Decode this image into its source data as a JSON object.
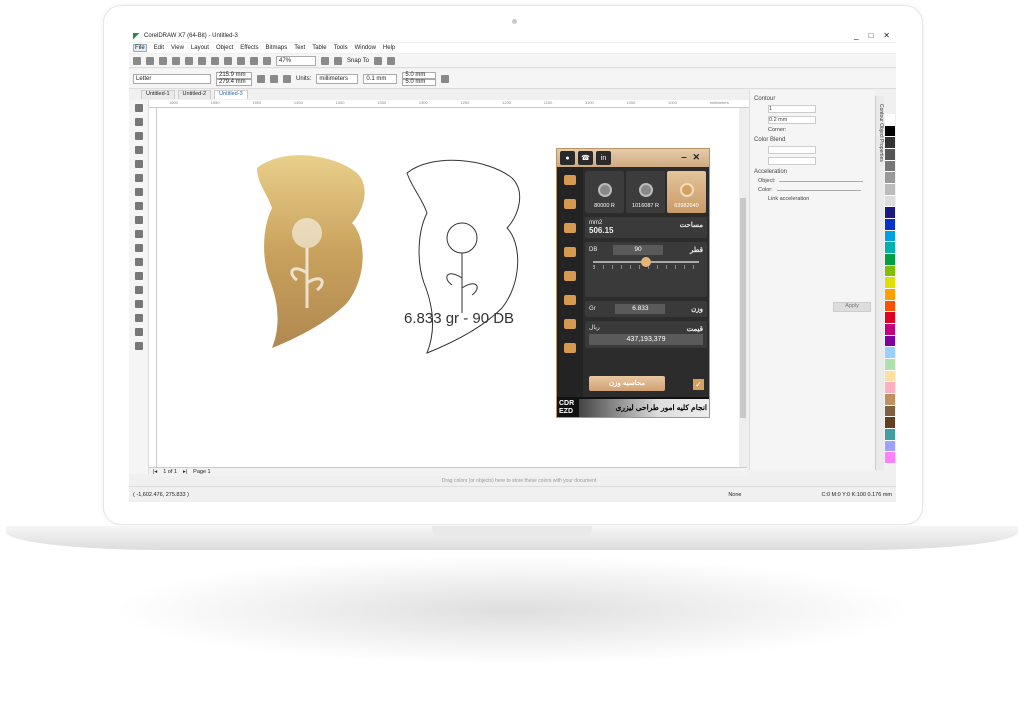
{
  "app": {
    "title": "CorelDRAW X7 (64-Bit) - Untitled-3",
    "window_controls": [
      "_",
      "□",
      "✕"
    ]
  },
  "menu": [
    "File",
    "Edit",
    "View",
    "Layout",
    "Object",
    "Effects",
    "Bitmaps",
    "Text",
    "Table",
    "Tools",
    "Window",
    "Help"
  ],
  "toolbar": {
    "zoom": "47%",
    "snap": "Snap To"
  },
  "propbar": {
    "page_size": "Letter",
    "width": "215.9 mm",
    "height": "279.4 mm",
    "units_label": "Units:",
    "units": "millimeters",
    "nudge": "0.1 mm",
    "dup_x": "5.0 mm",
    "dup_y": "5.0 mm"
  },
  "tabs": [
    "Untitled-1",
    "Untitled-2",
    "Untitled-3"
  ],
  "ruler": {
    "unit": "millimeters",
    "ticks": [
      "1600",
      "1550",
      "1500",
      "1450",
      "1400",
      "1350",
      "1300",
      "1250",
      "1200",
      "1150",
      "1100",
      "1050",
      "1000"
    ]
  },
  "canvas": {
    "caption": "6.833 gr - 90 DB"
  },
  "pager": {
    "count": "1 of 1",
    "page": "Page 1"
  },
  "palette_hint": "Drag colors (or objects) here to store these colors with your document",
  "status": {
    "coords": "( -1,602.476, 275.833 )",
    "fill": "None",
    "outline": "C:0 M:0 Y:0 K:100  0.176 mm"
  },
  "docker": {
    "title": "Contour",
    "steps": "1",
    "offset": "0.2 mm",
    "corner_label": "Corner:",
    "color_blend": "Color Blend",
    "acceleration": "Acceleration",
    "object_label": "Object:",
    "color_label": "Color:",
    "link": "Link acceleration",
    "apply": "Apply",
    "side_tabs": "Contour    Object Properties"
  },
  "plugin": {
    "cards": [
      {
        "label": "80000 R"
      },
      {
        "label": "1016087 R"
      },
      {
        "label": "63982640"
      }
    ],
    "area": {
      "unit": "mm2",
      "value": "506.15",
      "label": "مساحت"
    },
    "thickness": {
      "unit": "DB",
      "value": "90",
      "label": "قطر",
      "slider_percent": 50
    },
    "weight": {
      "unit": "Gr",
      "value": "6.833",
      "label": "وزن"
    },
    "price": {
      "unit": "ریال",
      "value": "437,193,379",
      "label": "قیمت"
    },
    "calc_button": "محاسبه وزن",
    "footer_brand": "CDR EZD",
    "footer_banner": "انجام کلیه امور طراحی لیزری"
  },
  "colors": {
    "gold": "#c9a06a",
    "dark": "#2c2c2c",
    "accent": "#d49a4e"
  }
}
